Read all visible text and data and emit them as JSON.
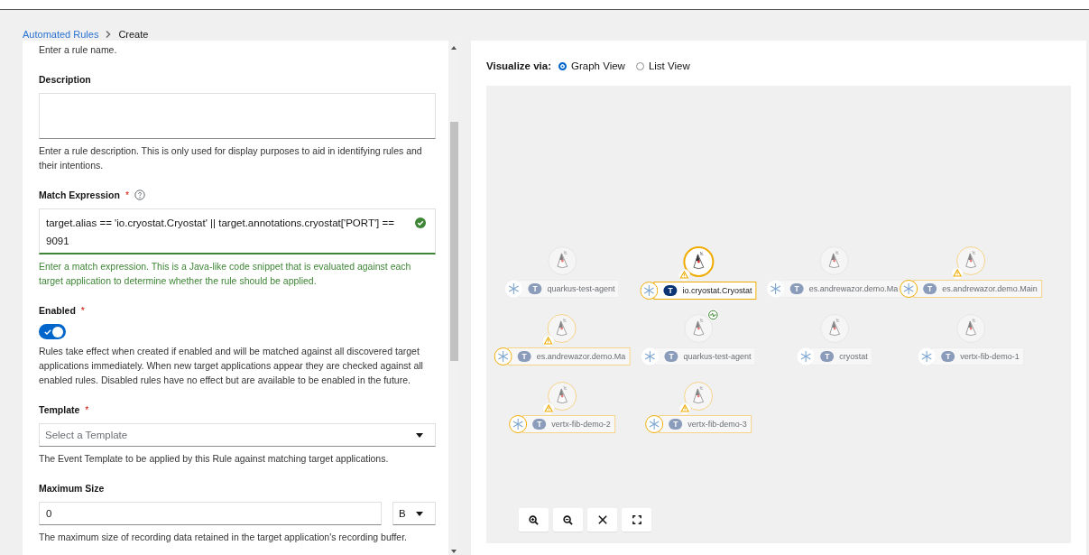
{
  "breadcrumb": [
    "Automated Rules",
    "Create"
  ],
  "form": {
    "name_helper": "Enter a rule name.",
    "description": {
      "label": "Description",
      "helper": "Enter a rule description. This is only used for display purposes to aid in identifying rules and their intentions."
    },
    "match_expression": {
      "label": "Match Expression",
      "required_mark": "*",
      "value": "target.alias == 'io.cryostat.Cryostat' || target.annotations.cryostat['PORT'] == 9091",
      "valid": true,
      "helper": "Enter a match expression. This is a Java-like code snippet that is evaluated against each target application to determine whether the rule should be applied."
    },
    "enabled": {
      "label": "Enabled",
      "required_mark": "*",
      "on": true,
      "helper": "Rules take effect when created if enabled and will be matched against all discovered target applications immediately. When new target applications appear they are checked against all enabled rules. Disabled rules have no effect but are available to be enabled in the future."
    },
    "template": {
      "label": "Template",
      "required_mark": "*",
      "placeholder": "Select a Template",
      "helper": "The Event Template to be applied by this Rule against matching target applications."
    },
    "maximum_size": {
      "label": "Maximum Size",
      "value": "0",
      "unit": "B",
      "helper": "The maximum size of recording data retained in the target application's recording buffer."
    }
  },
  "visualize": {
    "label": "Visualize via:",
    "options": [
      {
        "label": "Graph View",
        "selected": true
      },
      {
        "label": "List View",
        "selected": false
      }
    ]
  },
  "graph": {
    "nodes": [
      {
        "tag": "T",
        "label": "quarkus-test-agent",
        "selected": false,
        "warning": false,
        "healthy": false
      },
      {
        "tag": "T",
        "label": "io.cryostat.Cryostat",
        "selected": true,
        "warning": true,
        "healthy": false
      },
      {
        "tag": "T",
        "label": "es.andrewazor.demo.Ma",
        "selected": false,
        "warning": false,
        "healthy": false
      },
      {
        "tag": "T",
        "label": "es.andrewazor.demo.Main",
        "selected": false,
        "warning": true,
        "healthy": false
      },
      {
        "tag": "T",
        "label": "es.andrewazor.demo.Ma",
        "selected": false,
        "warning": true,
        "healthy": false
      },
      {
        "tag": "T",
        "label": "quarkus-test-agent",
        "selected": false,
        "warning": false,
        "healthy": true
      },
      {
        "tag": "T",
        "label": "cryostat",
        "selected": false,
        "warning": false,
        "healthy": false
      },
      {
        "tag": "T",
        "label": "vertx-fib-demo-1",
        "selected": false,
        "warning": false,
        "healthy": false
      },
      {
        "tag": "T",
        "label": "vertx-fib-demo-2",
        "selected": false,
        "warning": true,
        "healthy": false
      },
      {
        "tag": "T",
        "label": "vertx-fib-demo-3",
        "selected": false,
        "warning": true,
        "healthy": false
      }
    ]
  }
}
